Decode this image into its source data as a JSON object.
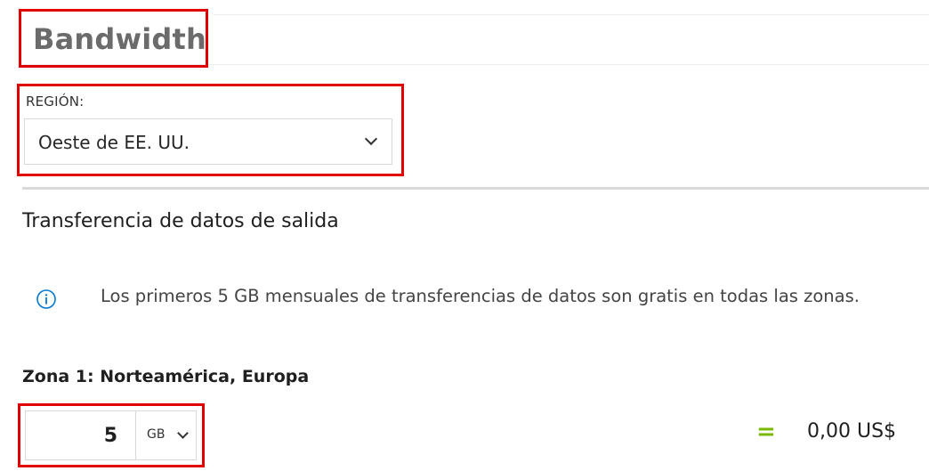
{
  "header": {
    "title": "Bandwidth"
  },
  "region": {
    "label": "REGIÓN:",
    "selected": "Oeste de EE. UU."
  },
  "outbound": {
    "heading": "Transferencia de datos de salida",
    "info_text": "Los primeros 5 GB mensuales de transferencias de datos son gratis en todas las zonas.",
    "info_icon": "info-icon"
  },
  "zone1": {
    "title": "Zona 1: Norteamérica, Europa",
    "quantity": "5",
    "unit": "GB",
    "equals_symbol": "=",
    "price": "0,00 US$"
  },
  "colors": {
    "highlight_border": "#e00000",
    "info_blue": "#0078d4",
    "equals_green": "#7ab800"
  }
}
